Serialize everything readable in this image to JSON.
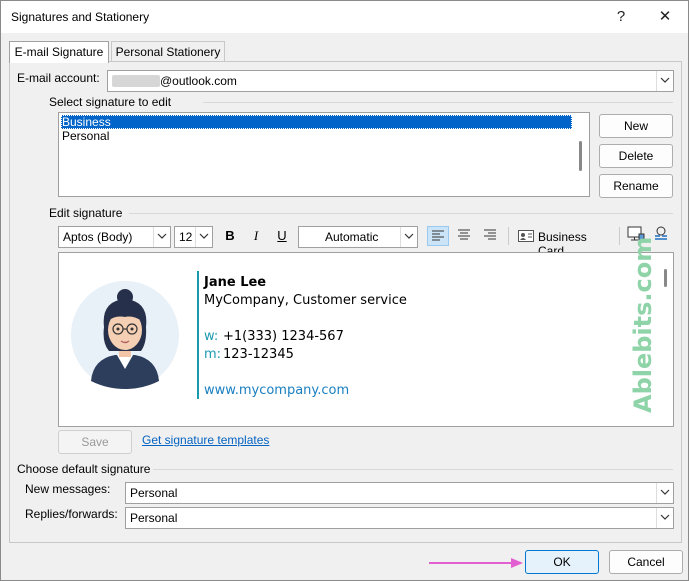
{
  "window": {
    "title": "Signatures and Stationery",
    "help_glyph": "?",
    "close_glyph": "✕"
  },
  "tabs": [
    {
      "label": "E-mail Signature"
    },
    {
      "label": "Personal Stationery"
    }
  ],
  "email_account": {
    "label": "E-mail account:",
    "value": "@outlook.com"
  },
  "select_signature": {
    "header": "Select signature to edit",
    "items": [
      "Business",
      "Personal"
    ],
    "selected": "Business",
    "buttons": {
      "new": "New",
      "delete": "Delete",
      "rename": "Rename"
    }
  },
  "edit_signature": {
    "header": "Edit signature",
    "font_family": "Aptos (Body)",
    "font_size": "12",
    "bold": "B",
    "italic": "I",
    "underline": "U",
    "color": "Automatic",
    "business_card": "Business Card"
  },
  "signature": {
    "name": "Jane Lee",
    "company": "MyCompany, Customer service",
    "phone_label": "w:",
    "phone": "+1(333) 1234-567",
    "mobile_label": "m:",
    "mobile": "123-12345",
    "website": "www.mycompany.com",
    "watermark": "Ablebits.com",
    "accent_color": "#1a9ab0",
    "watermark_color": "#8fd3a8"
  },
  "save_button": "Save",
  "templates_link": "Get signature templates",
  "default_signature": {
    "header": "Choose default signature",
    "new_messages_label": "New messages:",
    "new_messages_value": "Personal",
    "replies_label": "Replies/forwards:",
    "replies_value": "Personal"
  },
  "footer": {
    "ok": "OK",
    "cancel": "Cancel"
  }
}
